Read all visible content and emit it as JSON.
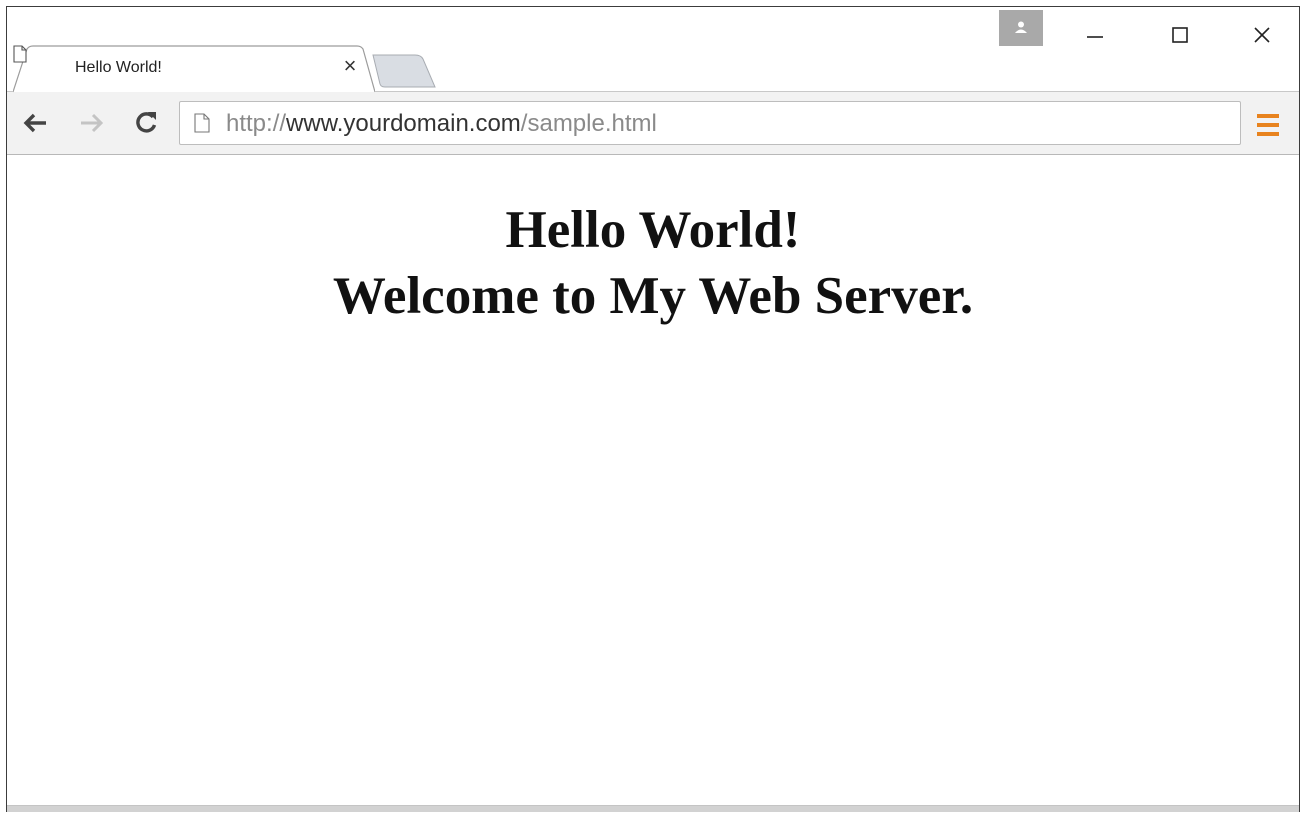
{
  "window": {
    "controls": {
      "minimize_icon": "minimize-icon",
      "maximize_icon": "maximize-icon",
      "close_icon": "close-icon",
      "profile_icon": "profile-person-icon"
    }
  },
  "tab": {
    "title": "Hello World!",
    "close_label": "×",
    "icon": "page-icon"
  },
  "toolbar": {
    "back_icon": "arrow-left-icon",
    "forward_icon": "arrow-right-icon",
    "reload_icon": "reload-icon",
    "menu_icon": "hamburger-menu-icon",
    "url": {
      "scheme": "http://",
      "host": "www.yourdomain.com",
      "path": "/sample.html"
    }
  },
  "page": {
    "heading_line1": "Hello World!",
    "heading_line2": "Welcome to My Web Server."
  },
  "colors": {
    "menu_icon": "#e8831e",
    "profile_button": "#a9a9a9",
    "toolbar_bg": "#f2f2f2",
    "url_dim": "#8a8a8a",
    "url_host": "#333333"
  }
}
